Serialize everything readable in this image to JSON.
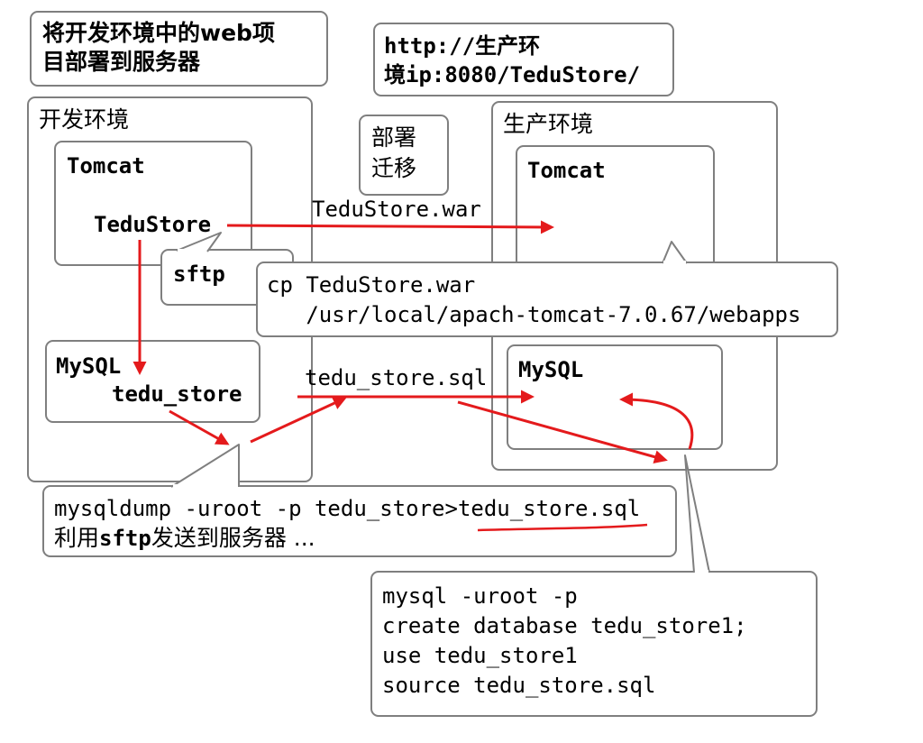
{
  "notes": {
    "top_left_line1": "将开发环境中的web项",
    "top_left_line2": "目部署到服务器",
    "url_line1": "http://生产环",
    "url_line2": "境ip:8080/TeduStore/",
    "migrate_line1": "部署",
    "migrate_line2": "迁移"
  },
  "dev": {
    "title": "开发环境",
    "tomcat": "Tomcat",
    "app": "TeduStore",
    "sftp": "sftp",
    "mysql": "MySQL",
    "db": "tedu_store"
  },
  "prod": {
    "title": "生产环境",
    "tomcat": "Tomcat",
    "mysql": "MySQL"
  },
  "arrows": {
    "war": "TeduStore.war",
    "sql": "tedu_store.sql"
  },
  "cp_callout": {
    "line1": "cp TeduStore.war",
    "line2": "   /usr/local/apach-tomcat-7.0.67/webapps"
  },
  "dump_callout": {
    "line1_cmd": "mysqldump -uroot -p tedu_store>",
    "line1_file": "tedu_store.sql",
    "line2_a": "利用",
    "line2_b": "sftp",
    "line2_c": "发送到服务器 ..."
  },
  "mysql_callout": {
    "line1": "mysql -uroot -p",
    "line2": "create database tedu_store1;",
    "line3": "use tedu_store1",
    "line4": "source tedu_store.sql"
  },
  "colors": {
    "arrow": "#e41a1c",
    "border": "#7f7f7f"
  }
}
